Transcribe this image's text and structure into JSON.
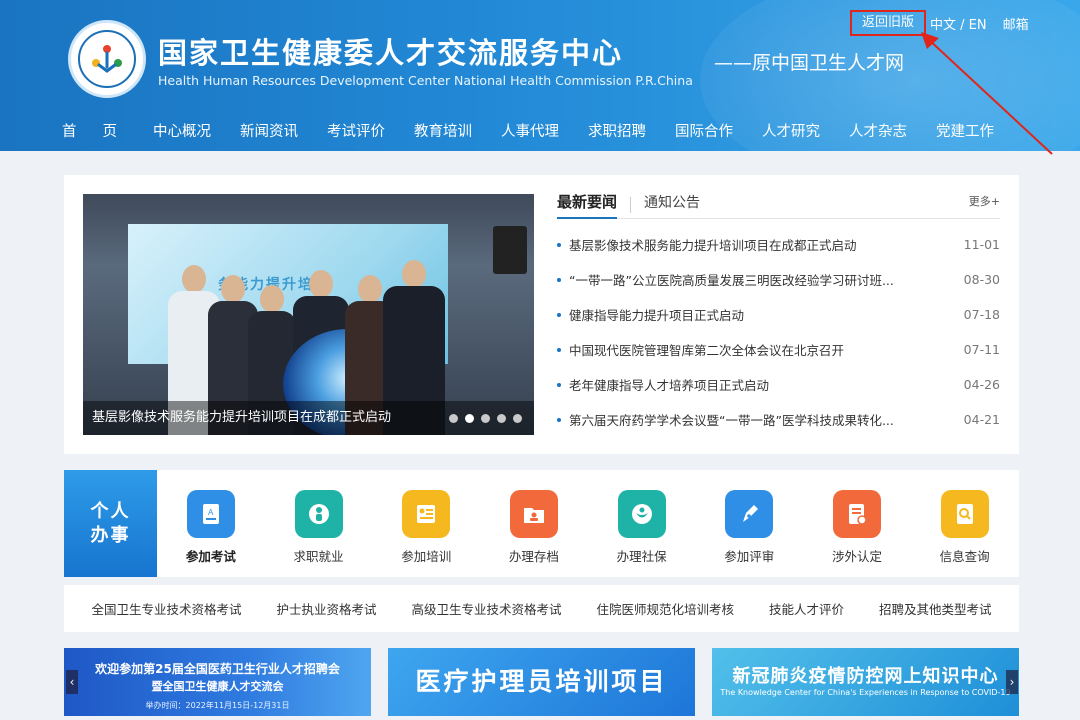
{
  "header": {
    "title_cn": "国家卫生健康委人才交流服务中心",
    "title_en": "Health Human Resources Development Center National Health Commission P.R.China",
    "subtitle": "——原中国卫生人才网",
    "top_links": {
      "old_version": "返回旧版",
      "language": "中文 / EN",
      "mail": "邮箱"
    }
  },
  "nav": [
    "首页",
    "中心概况",
    "新闻资讯",
    "考试评价",
    "教育培训",
    "人事代理",
    "求职招聘",
    "国际合作",
    "人才研究",
    "人才杂志",
    "党建工作"
  ],
  "slider": {
    "caption": "基层影像技术服务能力提升培训项目在成都正式启动",
    "screen_text": "务能力提升培训",
    "dots": 5,
    "active_dot": 1
  },
  "news": {
    "tab_active": "最新要闻",
    "tab_other": "通知公告",
    "more": "更多+",
    "items": [
      {
        "title": "基层影像技术服务能力提升培训项目在成都正式启动",
        "date": "11-01"
      },
      {
        "title": "“一带一路”公立医院高质量发展三明医改经验学习研讨班...",
        "date": "08-30"
      },
      {
        "title": "健康指导能力提升项目正式启动",
        "date": "07-18"
      },
      {
        "title": "中国现代医院管理智库第二次全体会议在北京召开",
        "date": "07-11"
      },
      {
        "title": "老年健康指导人才培养项目正式启动",
        "date": "04-26"
      },
      {
        "title": "第六届天府药学学术会议暨“一带一路”医学科技成果转化...",
        "date": "04-21"
      }
    ]
  },
  "services": {
    "heading": "个人办事",
    "items": [
      {
        "label": "参加考试",
        "icon": "exam-doc-icon",
        "color": "#2f8fe6"
      },
      {
        "label": "求职就业",
        "icon": "job-person-icon",
        "color": "#1fb3a7"
      },
      {
        "label": "参加培训",
        "icon": "training-board-icon",
        "color": "#f5b81e"
      },
      {
        "label": "办理存档",
        "icon": "archive-folder-icon",
        "color": "#f26a3b"
      },
      {
        "label": "办理社保",
        "icon": "social-security-icon",
        "color": "#1fb3a7"
      },
      {
        "label": "参加评审",
        "icon": "review-pen-icon",
        "color": "#2f8fe6"
      },
      {
        "label": "涉外认定",
        "icon": "foreign-certify-icon",
        "color": "#f26a3b"
      },
      {
        "label": "信息查询",
        "icon": "info-search-icon",
        "color": "#f5b81e"
      }
    ]
  },
  "exams": [
    "全国卫生专业技术资格考试",
    "护士执业资格考试",
    "高级卫生专业技术资格考试",
    "住院医师规范化培训考核",
    "技能人才评价",
    "招聘及其他类型考试"
  ],
  "banners": {
    "banner1": {
      "line1": "欢迎参加第25届全国医药卫生行业人才招聘会",
      "line2": "暨全国卫生健康人才交流会",
      "line3": "举办时间：2022年11月15日-12月31日"
    },
    "banner2": {
      "text": "医疗护理员培训项目"
    },
    "banner3": {
      "line1": "新冠肺炎疫情防控网上知识中心",
      "line2": "The Knowledge Center for China's Experiences in Response to COVID-19"
    }
  },
  "colors": {
    "header": "#1a74c1",
    "accent": "#1a74c1",
    "annotation": "#e0261c"
  }
}
